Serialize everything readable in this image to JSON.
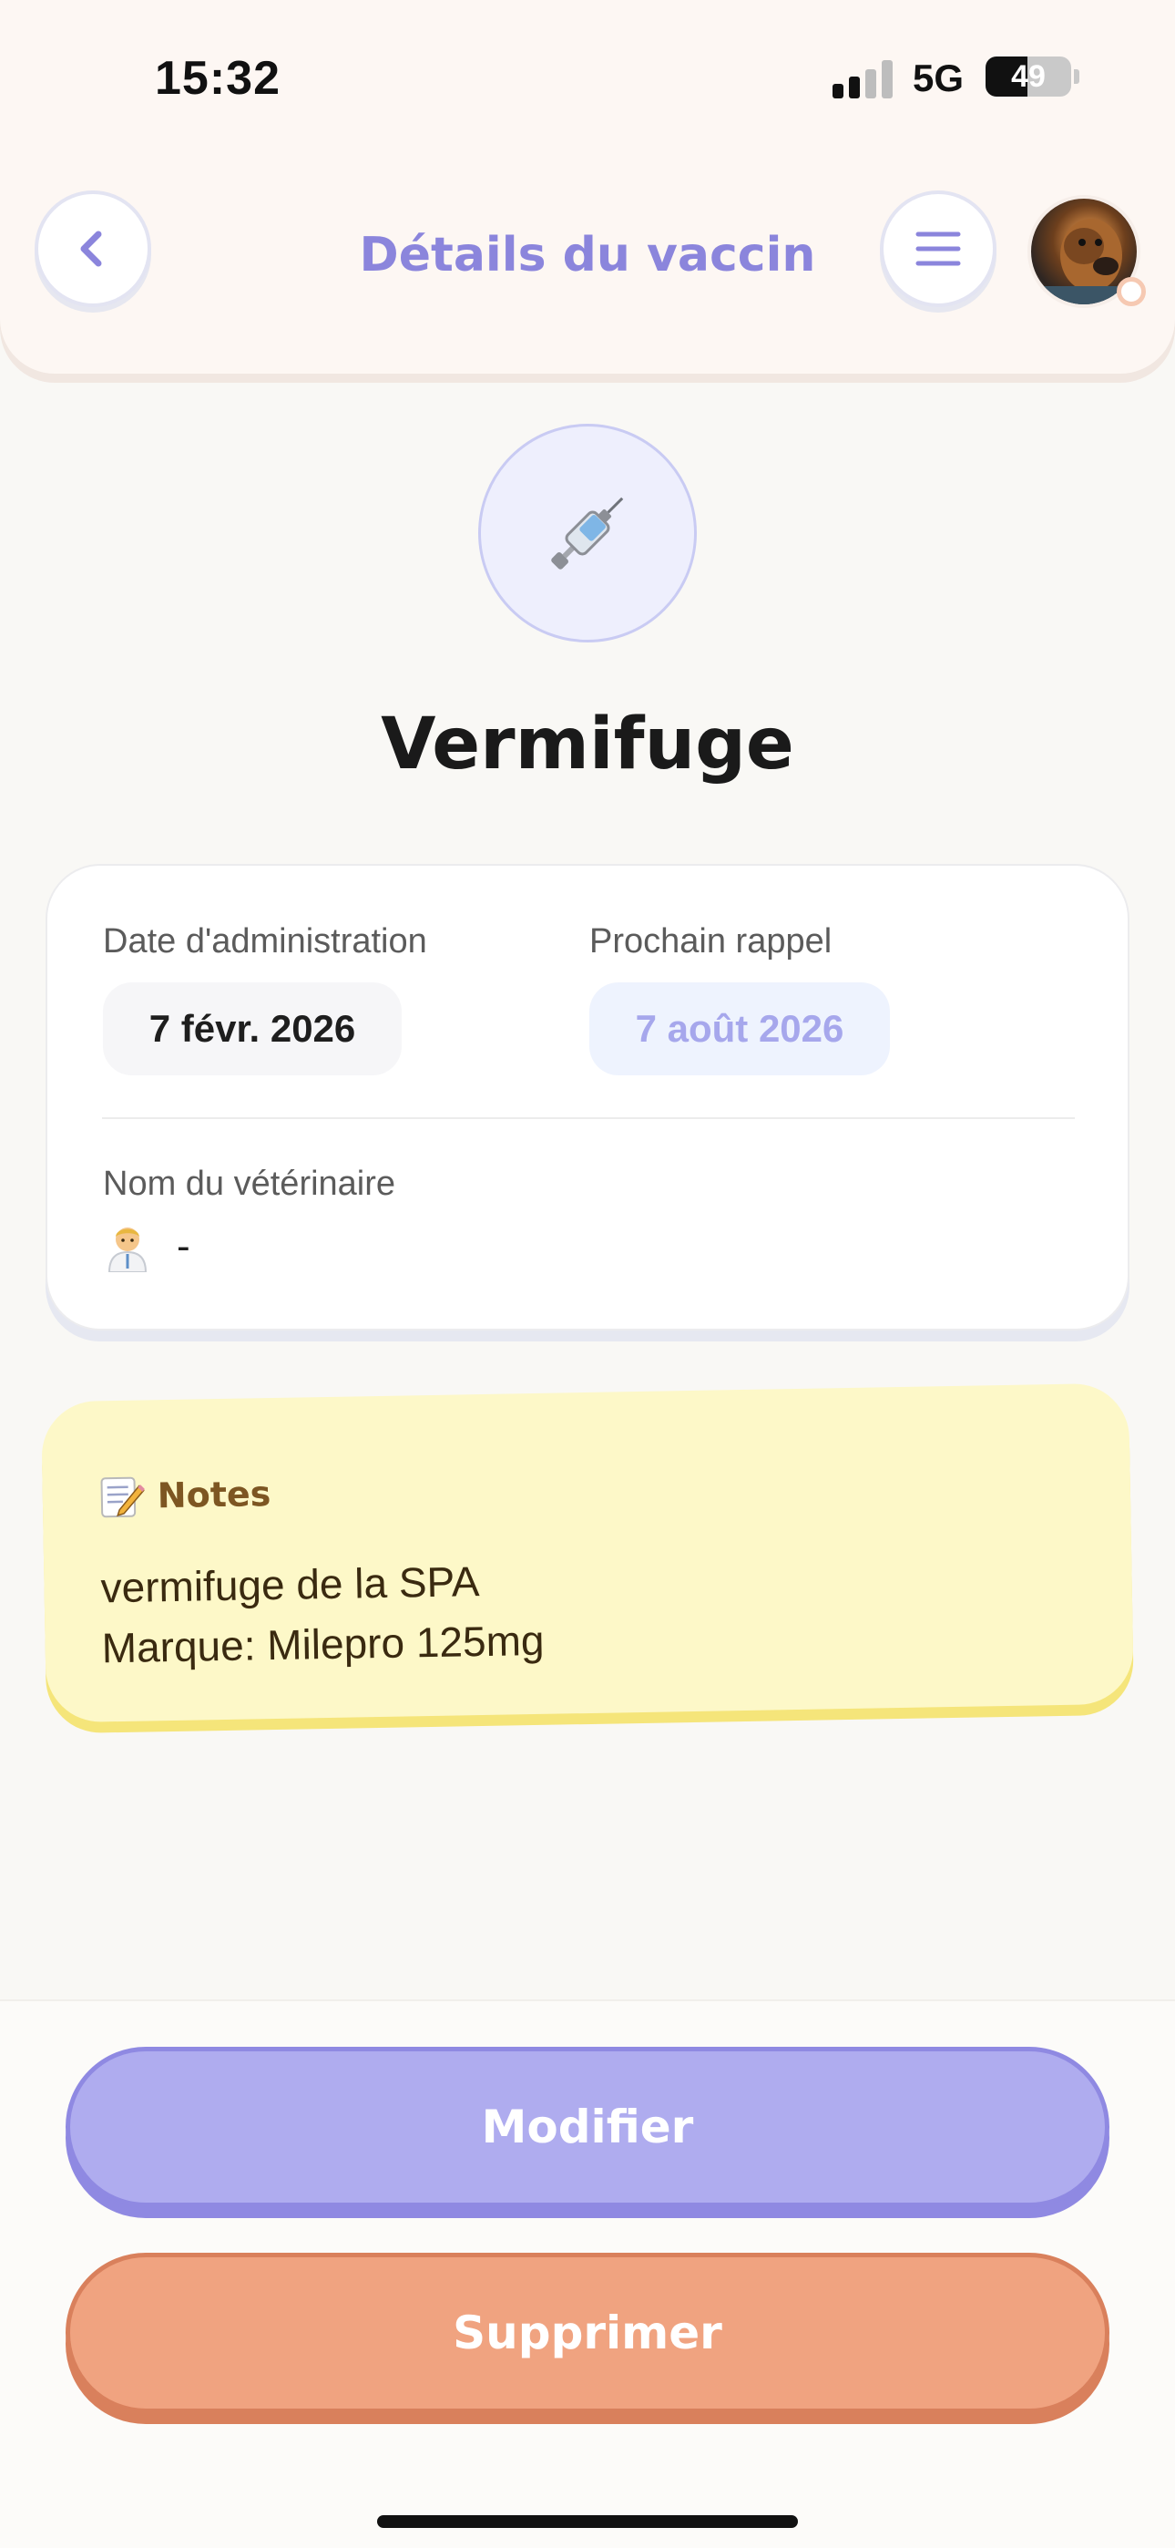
{
  "status_bar": {
    "time": "15:32",
    "network": "5G",
    "battery_level": "49",
    "battery_fraction": 0.49,
    "signal_bars_active": 2,
    "signal_bars_total": 4
  },
  "header": {
    "title": "Détails du vaccin",
    "back_icon": "chevron-left-icon",
    "menu_icon": "hamburger-menu-icon",
    "avatar": "pet-avatar"
  },
  "vaccine": {
    "icon": "syringe-icon",
    "name": "Vermifuge"
  },
  "details": {
    "admin_label": "Date d'administration",
    "admin_date": "7 févr. 2026",
    "next_label": "Prochain rappel",
    "next_date": "7 août 2026",
    "vet_label": "Nom du vétérinaire",
    "vet_icon": "veterinarian-icon",
    "vet_name": "-"
  },
  "notes": {
    "icon": "memo-icon",
    "title": "Notes",
    "lines": [
      "vermifuge de la SPA",
      "Marque: Milepro 125mg"
    ]
  },
  "actions": {
    "edit_label": "Modifier",
    "delete_label": "Supprimer"
  },
  "colors": {
    "accent": "#8b85dc",
    "edit_button": "#afacef",
    "delete_button": "#f0a380",
    "notes_background": "#fdf8c8"
  }
}
